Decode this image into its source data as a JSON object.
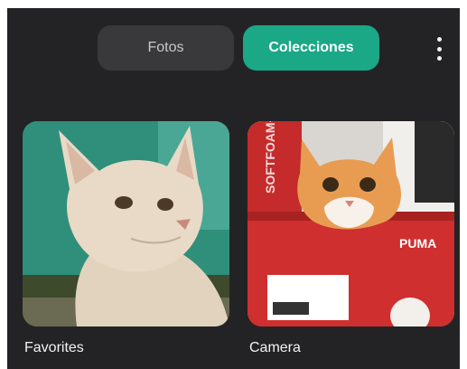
{
  "tabs": {
    "photos_label": "Fotos",
    "collections_label": "Colecciones",
    "active": "Colecciones"
  },
  "menu": {
    "icon": "more-vert-icon"
  },
  "collections": [
    {
      "label": "Favorites"
    },
    {
      "label": "Camera",
      "box_brand": "PUMA",
      "box_text": "SOFTFOAM+"
    }
  ],
  "colors": {
    "background": "#232325",
    "active_tab": "#1aa887",
    "inactive_tab": "#39393b",
    "text": "#f2f2f2"
  }
}
